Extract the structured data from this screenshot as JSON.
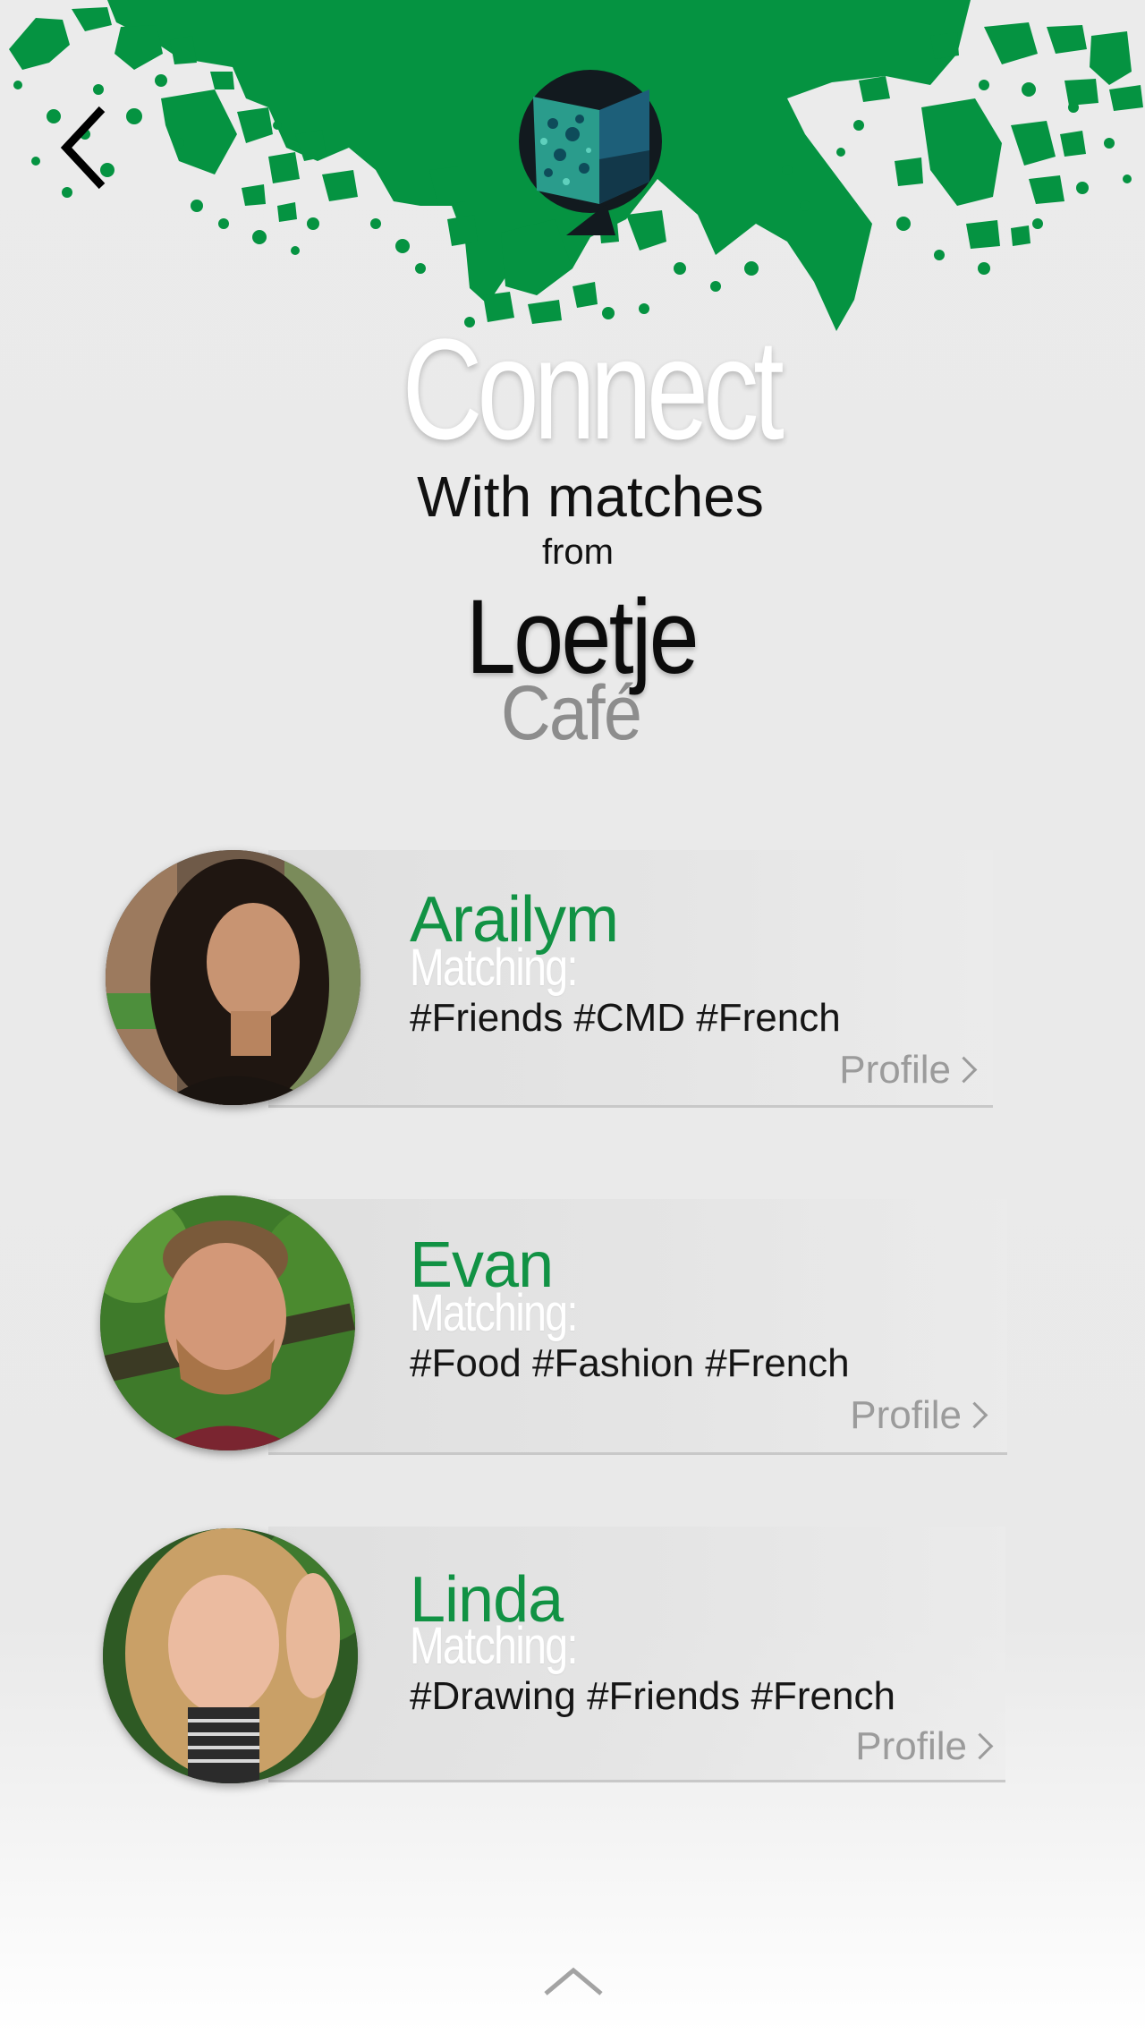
{
  "header": {
    "back_icon": "chevron-left-icon",
    "logo_icon": "app-logo-icon",
    "brand_color": "#119244"
  },
  "hero": {
    "title": "Connect",
    "subtitle": "With matches",
    "from": "from",
    "venue_name": "Loetje",
    "venue_type": "Café"
  },
  "matches": [
    {
      "name": "Arailym",
      "label": "Matching:",
      "tags": "#Friends #CMD #French",
      "profile_label": "Profile"
    },
    {
      "name": "Evan",
      "label": "Matching:",
      "tags": "#Food #Fashion #French",
      "profile_label": "Profile"
    },
    {
      "name": "Linda",
      "label": "Matching:",
      "tags": "#Drawing #Friends #French",
      "profile_label": "Profile"
    }
  ],
  "footer": {
    "up_icon": "chevron-up-icon"
  }
}
